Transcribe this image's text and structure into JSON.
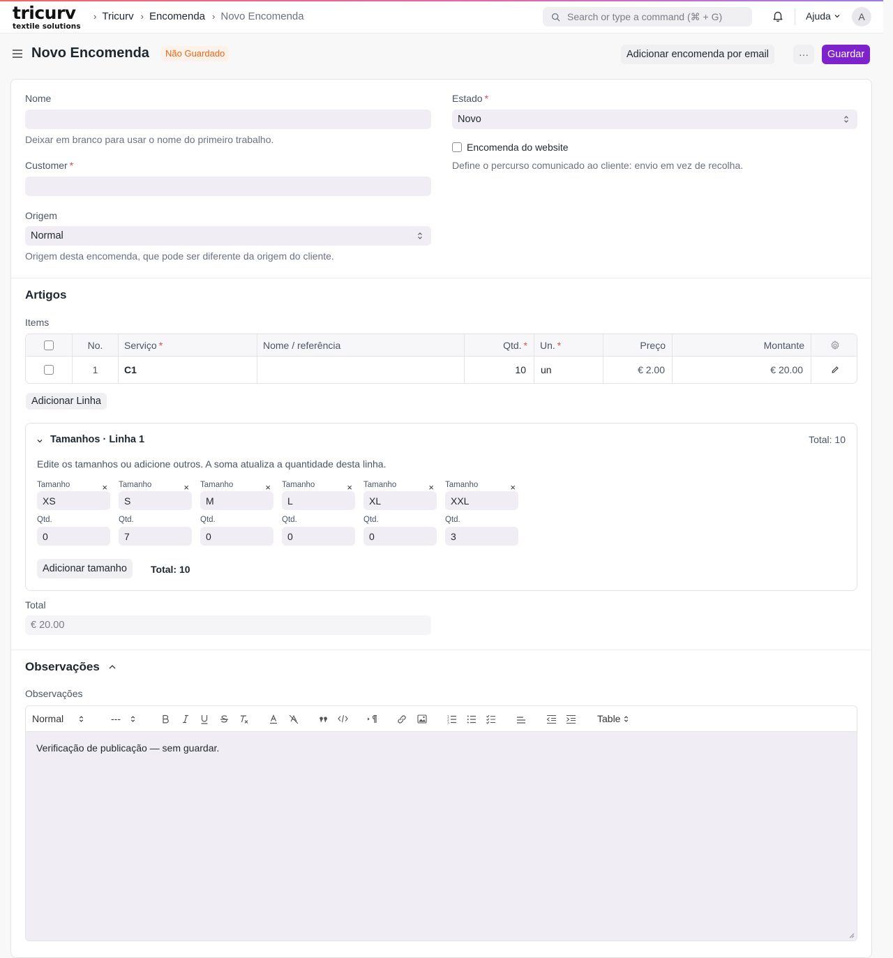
{
  "brand": {
    "name": "tricurv",
    "tagline": "textile solutions"
  },
  "breadcrumbs": [
    "Tricurv",
    "Encomenda",
    "Novo Encomenda"
  ],
  "search": {
    "placeholder": "Search or type a command (⌘ + G)"
  },
  "nav": {
    "help_label": "Ajuda",
    "avatar_initial": "A"
  },
  "page": {
    "title": "Novo Encomenda",
    "status": "Não Guardado",
    "email_button": "Adicionar encomenda por email",
    "more_button": "···",
    "save_button": "Guardar"
  },
  "form": {
    "nome": {
      "label": "Nome",
      "value": "",
      "help": "Deixar em branco para usar o nome do primeiro trabalho."
    },
    "customer": {
      "label": "Customer",
      "value": ""
    },
    "origem": {
      "label": "Origem",
      "value": "Normal",
      "help": "Origem desta encomenda, que pode ser diferente da origem do cliente."
    },
    "estado": {
      "label": "Estado",
      "value": "Novo"
    },
    "website": {
      "label": "Encomenda do website",
      "checked": false,
      "help": "Define o percurso comunicado ao cliente: envio em vez de recolha."
    }
  },
  "artigos": {
    "section_title": "Artigos",
    "items_label": "Items",
    "columns": [
      "No.",
      "Serviço",
      "Nome / referência",
      "Qtd.",
      "Un.",
      "Preço",
      "Montante"
    ],
    "rows": [
      {
        "no": "1",
        "servico": "C1",
        "nome": "",
        "qtd": "10",
        "un": "un",
        "preco": "€ 2.00",
        "montante": "€ 20.00"
      }
    ],
    "add_row_button": "Adicionar Linha"
  },
  "tamanhos": {
    "title": "Tamanhos · Linha 1",
    "total_label": "Total: 10",
    "description": "Edite os tamanhos ou adicione outros. A soma atualiza a quantidade desta linha.",
    "size_label": "Tamanho",
    "qty_label": "Qtd.",
    "remove_icon": "×",
    "sizes": [
      {
        "size": "XS",
        "qty": "0"
      },
      {
        "size": "S",
        "qty": "7"
      },
      {
        "size": "M",
        "qty": "0"
      },
      {
        "size": "L",
        "qty": "0"
      },
      {
        "size": "XL",
        "qty": "0"
      },
      {
        "size": "XXL",
        "qty": "3"
      }
    ],
    "add_size_button": "Adicionar tamanho",
    "sum_text": "Total: 10"
  },
  "total": {
    "label": "Total",
    "value": "€ 20.00"
  },
  "observacoes": {
    "section_title": "Observações",
    "field_label": "Observações",
    "toolbar": {
      "paragraph": "Normal",
      "size": "---",
      "table": "Table"
    },
    "content": "Verificação de publicação — sem guardar."
  },
  "colors": {
    "primary": "#7e22ce",
    "status_orange": "#e2681a",
    "required_red": "#e24c4c",
    "field_bg": "#f0eef4"
  }
}
